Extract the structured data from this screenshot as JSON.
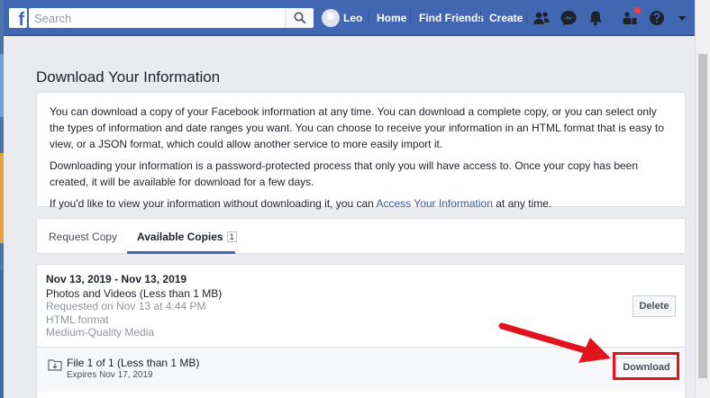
{
  "header": {
    "logo": "f",
    "search_placeholder": "Search",
    "user_name": "Leo",
    "nav": [
      "Home",
      "Find Friends",
      "Create"
    ],
    "icons": [
      "friends-icon",
      "messenger-icon",
      "notifications-icon",
      "quick-help-icon",
      "help-icon",
      "dropdown-icon"
    ]
  },
  "page": {
    "title": "Download Your Information",
    "intro": {
      "p1": "You can download a copy of your Facebook information at any time. You can download a complete copy, or you can select only the types of information and date ranges you want. You can choose to receive your information in an HTML format that is easy to view, or a JSON format, which could allow another service to more easily import it.",
      "p2": "Downloading your information is a password-protected process that only you will have access to. Once your copy has been created, it will be available for download for a few days.",
      "p3_before": "If you'd like to view your information without downloading it, you can ",
      "p3_link": "Access Your Information",
      "p3_after": " at any time."
    },
    "tabs": {
      "request": "Request Copy",
      "available": "Available Copies",
      "available_count": "1"
    },
    "copy": {
      "range": "Nov 13, 2019 - Nov 13, 2019",
      "type": "Photos and Videos (Less than 1 MB)",
      "requested": "Requested on Nov 13 at 4:44 PM",
      "format": "HTML format",
      "quality": "Medium-Quality Media",
      "delete_label": "Delete",
      "file_name": "File 1 of 1 (Less than 1 MB)",
      "file_expires": "Expires Nov 17, 2019",
      "download_label": "Download"
    }
  },
  "colors": {
    "brand": "#4267b2",
    "link": "#365899",
    "annotation": "#e0141e"
  }
}
